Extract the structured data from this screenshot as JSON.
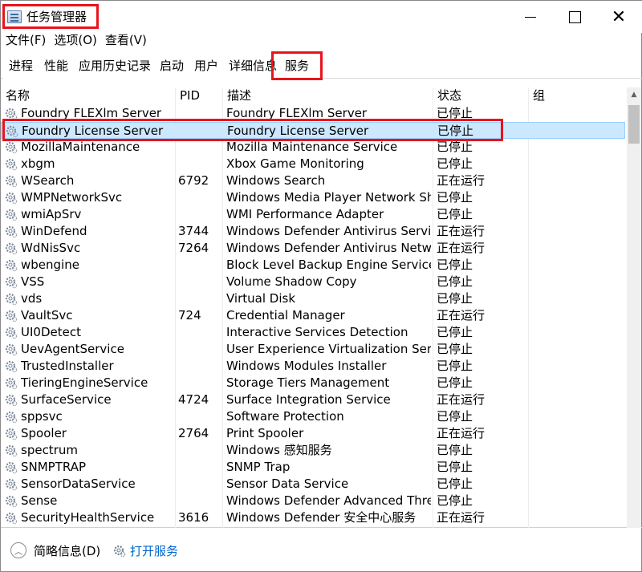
{
  "window": {
    "title": "任务管理器"
  },
  "menu": [
    "文件(F)",
    "选项(O)",
    "查看(V)"
  ],
  "tabs": [
    "进程",
    "性能",
    "应用历史记录",
    "启动",
    "用户",
    "详细信息",
    "服务"
  ],
  "active_tab": "服务",
  "columns": {
    "name": "名称",
    "pid": "PID",
    "desc": "描述",
    "status": "状态",
    "group": "组"
  },
  "rows": [
    {
      "name": "Foundry FLEXlm Server",
      "pid": "",
      "desc": "Foundry FLEXlm Server",
      "status": "已停止"
    },
    {
      "name": "Foundry License Server",
      "pid": "",
      "desc": "Foundry License Server",
      "status": "已停止",
      "selected": true
    },
    {
      "name": "MozillaMaintenance",
      "pid": "",
      "desc": "Mozilla Maintenance Service",
      "status": "已停止"
    },
    {
      "name": "xbgm",
      "pid": "",
      "desc": "Xbox Game Monitoring",
      "status": "已停止"
    },
    {
      "name": "WSearch",
      "pid": "6792",
      "desc": "Windows Search",
      "status": "正在运行"
    },
    {
      "name": "WMPNetworkSvc",
      "pid": "",
      "desc": "Windows Media Player Network Sh...",
      "status": "已停止"
    },
    {
      "name": "wmiApSrv",
      "pid": "",
      "desc": "WMI Performance Adapter",
      "status": "已停止"
    },
    {
      "name": "WinDefend",
      "pid": "3744",
      "desc": "Windows Defender Antivirus Service",
      "status": "正在运行"
    },
    {
      "name": "WdNisSvc",
      "pid": "7264",
      "desc": "Windows Defender Antivirus Netw...",
      "status": "正在运行"
    },
    {
      "name": "wbengine",
      "pid": "",
      "desc": "Block Level Backup Engine Service",
      "status": "已停止"
    },
    {
      "name": "VSS",
      "pid": "",
      "desc": "Volume Shadow Copy",
      "status": "已停止"
    },
    {
      "name": "vds",
      "pid": "",
      "desc": "Virtual Disk",
      "status": "已停止"
    },
    {
      "name": "VaultSvc",
      "pid": "724",
      "desc": "Credential Manager",
      "status": "正在运行"
    },
    {
      "name": "UI0Detect",
      "pid": "",
      "desc": "Interactive Services Detection",
      "status": "已停止"
    },
    {
      "name": "UevAgentService",
      "pid": "",
      "desc": "User Experience Virtualization Servi...",
      "status": "已停止"
    },
    {
      "name": "TrustedInstaller",
      "pid": "",
      "desc": "Windows Modules Installer",
      "status": "已停止"
    },
    {
      "name": "TieringEngineService",
      "pid": "",
      "desc": "Storage Tiers Management",
      "status": "已停止"
    },
    {
      "name": "SurfaceService",
      "pid": "4724",
      "desc": "Surface Integration Service",
      "status": "正在运行"
    },
    {
      "name": "sppsvc",
      "pid": "",
      "desc": "Software Protection",
      "status": "已停止"
    },
    {
      "name": "Spooler",
      "pid": "2764",
      "desc": "Print Spooler",
      "status": "正在运行"
    },
    {
      "name": "spectrum",
      "pid": "",
      "desc": "Windows 感知服务",
      "status": "已停止"
    },
    {
      "name": "SNMPTRAP",
      "pid": "",
      "desc": "SNMP Trap",
      "status": "已停止"
    },
    {
      "name": "SensorDataService",
      "pid": "",
      "desc": "Sensor Data Service",
      "status": "已停止"
    },
    {
      "name": "Sense",
      "pid": "",
      "desc": "Windows Defender Advanced Thre...",
      "status": "已停止"
    },
    {
      "name": "SecurityHealthService",
      "pid": "3616",
      "desc": "Windows Defender 安全中心服务",
      "status": "正在运行"
    }
  ],
  "footer": {
    "brief": "简略信息(D)",
    "open_services": "打开服务"
  },
  "colors": {
    "highlight": "#e8141c",
    "selection": "#cce8ff",
    "link": "#0066cc"
  },
  "icons": {
    "service": "gear-icon"
  }
}
